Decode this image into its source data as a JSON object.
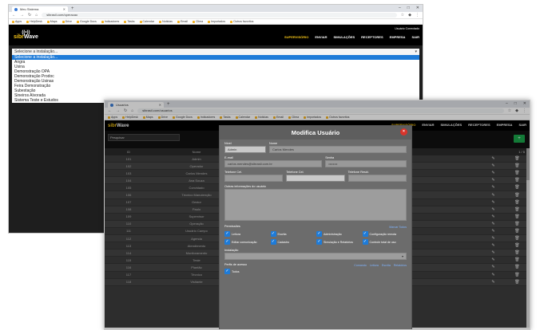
{
  "win1": {
    "tab_title": "Meu Sistema",
    "url": "sibrasil.com/operacao",
    "bookmarks": [
      "Apps",
      "HelpDesk",
      "Maps",
      "Drive",
      "Google Docs",
      "Indicadores",
      "Tasks",
      "Calendar",
      "Noticias",
      "Email",
      "Clima",
      "Importados",
      "Outros favoritos"
    ],
    "user": "Usuário Conectado",
    "menu": [
      "SUPERVISÓRIO",
      "ENVIAR",
      "SIMULAÇÕES",
      "RECEPTORES",
      "EMPRESA",
      "SAIR"
    ],
    "select_value": "Selecione a instalação...",
    "options": [
      "Selecione a instalação...",
      "Angra",
      "Usina",
      "Demonstração OPA",
      "Demonstração Prodoc",
      "Demonstração Usinas",
      "Feira Demonstração",
      "Subestação",
      "Sineiros Alvorada",
      "Sistema Teste e Estudos"
    ]
  },
  "win2": {
    "tab_title": "Usuarios",
    "url": "sibrasil.com/usuarios",
    "bookmarks": [
      "Apps",
      "HelpDesk",
      "Maps",
      "Drive",
      "Google Docs",
      "Indicadores",
      "Tasks",
      "Calendar",
      "Noticias",
      "Email",
      "Clima",
      "Importados",
      "Outros favoritos"
    ],
    "menu": [
      "SUPERVISÓRIO",
      "ENVIAR",
      "SIMULAÇÕES",
      "RECEPTORES",
      "EMPRESA",
      "SAIR"
    ],
    "filter_placeholder": "Pesquisar",
    "add_label": "+",
    "pager": "1 / 5",
    "table": {
      "header": [
        "ID",
        "Nome"
      ],
      "rows": [
        [
          "101",
          "Admin"
        ],
        [
          "102",
          "Operador"
        ],
        [
          "103",
          "Carlos Mendes"
        ],
        [
          "104",
          "Ana Souza"
        ],
        [
          "105",
          "Convidado"
        ],
        [
          "106",
          "Técnico Manutenção"
        ],
        [
          "107",
          "Gestor"
        ],
        [
          "108",
          "Paulo"
        ],
        [
          "109",
          "Supervisor"
        ],
        [
          "110",
          "Operação"
        ],
        [
          "111",
          "Usuário Campo"
        ],
        [
          "112",
          "Agenda"
        ],
        [
          "113",
          "Atendimento"
        ],
        [
          "114",
          "Monitoramento"
        ],
        [
          "115",
          "Teste"
        ],
        [
          "116",
          "Plantão"
        ],
        [
          "117",
          "Técnico"
        ],
        [
          "118",
          "Visitante"
        ]
      ]
    },
    "modal": {
      "title": "Modifica Usuário",
      "close": "×",
      "labels": {
        "tipo": "Nível",
        "nome": "Nome",
        "email": "E-mail",
        "senha": "Senha",
        "tel1": "Telefone Cel.",
        "tel2": "Telefone Cel.",
        "tel3": "Telefone Resid.",
        "obs": "Outras informações do usuário",
        "permissoes": "Permissões",
        "marcar": "Marcar Todos",
        "instalacao": "Instalação",
        "perfis": "Perfis de acesso"
      },
      "values": {
        "tipo": "Admin",
        "nome": "Carlos Mendes",
        "email": "carlos.mendes@sibrasil.com.br",
        "senha": "••••••••"
      },
      "checkboxes": [
        "Leitura",
        "Escrita",
        "Administração",
        "Configuração remota",
        "Editar comunicação",
        "Cadastro",
        "Simulação e Relatórios",
        "Controle total de uso"
      ],
      "perfil_links": [
        "Comando",
        "Leitura",
        "Escrita",
        "Relatórios"
      ],
      "bottom_check": "Todos"
    }
  }
}
